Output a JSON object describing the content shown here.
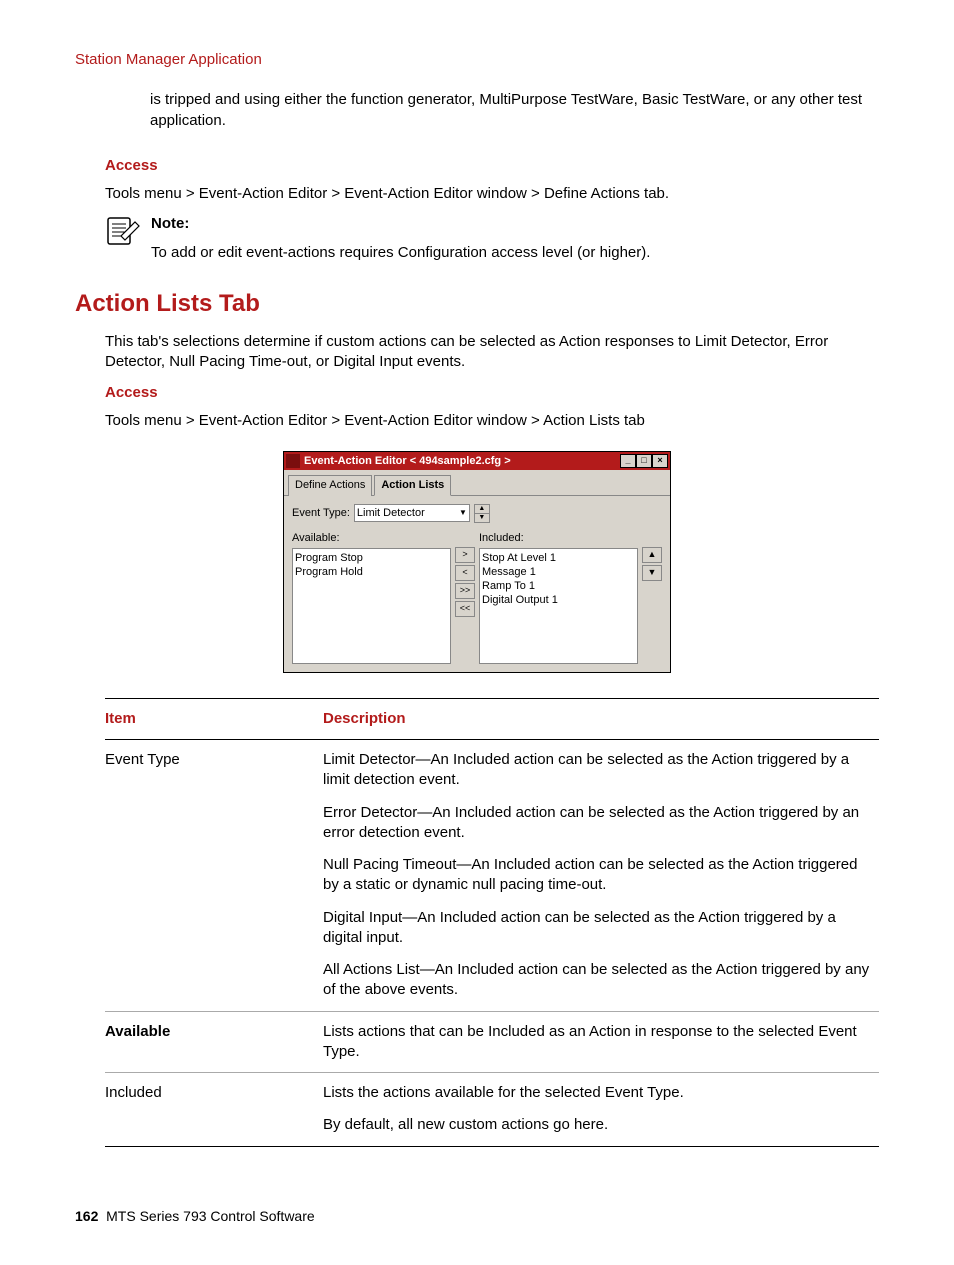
{
  "header_link": "Station Manager Application",
  "intro_continuation": "is tripped and using either the function generator, MultiPurpose TestWare, Basic TestWare, or any other test application.",
  "access1": {
    "label": "Access",
    "path": "Tools menu > Event-Action Editor > Event-Action Editor window > Define Actions tab."
  },
  "note": {
    "label": "Note:",
    "text": "To add or edit event-actions requires Configuration access level (or higher)."
  },
  "heading": "Action Lists Tab",
  "heading_para": "This tab's selections determine if custom actions can be selected as Action responses to Limit Detector, Error Detector, Null Pacing Time-out, or Digital Input events.",
  "access2": {
    "label": "Access",
    "path": "Tools menu > Event-Action Editor > Event-Action Editor window > Action Lists tab"
  },
  "app": {
    "title": "Event-Action Editor < 494sample2.cfg >",
    "tabs": {
      "define": "Define Actions",
      "lists": "Action Lists"
    },
    "event_type_label": "Event Type:",
    "event_type_value": "Limit Detector",
    "available_label": "Available:",
    "available_items": [
      "Program Stop",
      "Program Hold"
    ],
    "included_label": "Included:",
    "included_items": [
      "Stop At Level 1",
      "Message 1",
      "Ramp To 1",
      "Digital Output 1"
    ]
  },
  "table": {
    "head": {
      "c1": "Item",
      "c2": "Description"
    },
    "rows": [
      {
        "item": "Event Type",
        "bold": false,
        "blocks": [
          "Limit Detector—An Included action can be selected as the Action triggered by a limit detection event.",
          "Error Detector—An Included action can be selected as the Action triggered by an error detection event.",
          "Null Pacing Timeout—An Included action can be selected as the Action triggered by a static or dynamic null pacing time-out.",
          "Digital Input—An Included action can be selected as the Action triggered by a digital input.",
          "All Actions List—An Included action can be selected as the Action triggered by any of the above events."
        ]
      },
      {
        "item": "Available",
        "bold": true,
        "blocks": [
          "Lists actions that can be Included as an Action in response to the selected Event Type."
        ]
      },
      {
        "item": "Included",
        "bold": false,
        "blocks": [
          "Lists the actions available for the selected Event Type.",
          "By default, all new custom actions go here."
        ]
      }
    ]
  },
  "footer": {
    "page": "162",
    "title": "MTS Series 793 Control Software"
  }
}
